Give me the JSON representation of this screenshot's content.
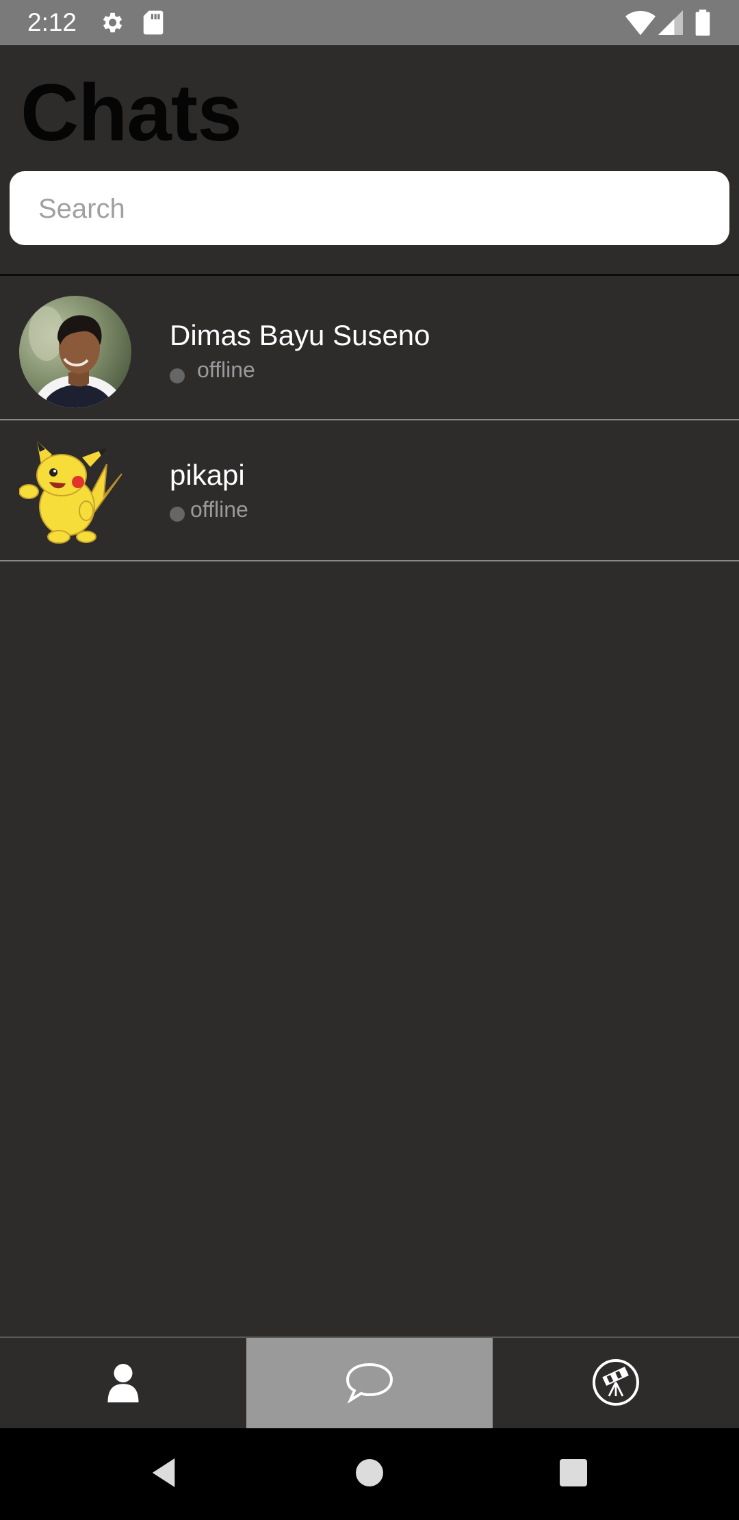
{
  "status_bar": {
    "time": "2:12",
    "icons": [
      "gear-icon",
      "sd-card-icon",
      "wifi-icon",
      "signal-icon",
      "battery-icon"
    ]
  },
  "header": {
    "title": "Chats"
  },
  "search": {
    "placeholder": "Search",
    "value": ""
  },
  "chats": [
    {
      "name": "Dimas Bayu Suseno",
      "status": "offline",
      "avatar": "person-photo"
    },
    {
      "name": "pikapi",
      "status": "offline",
      "avatar": "pikachu-image"
    }
  ],
  "bottom_nav": {
    "tabs": [
      {
        "icon": "user-icon",
        "active": false
      },
      {
        "icon": "chat-bubble-icon",
        "active": true
      },
      {
        "icon": "telescope-icon",
        "active": false
      }
    ]
  },
  "system_nav": {
    "icons": [
      "back-icon",
      "home-icon",
      "recents-icon"
    ]
  },
  "colors": {
    "background": "#2d2c2b",
    "status_bar": "#7a7a7a",
    "active_tab": "#9a9a9a",
    "status_dot": "#666666"
  }
}
